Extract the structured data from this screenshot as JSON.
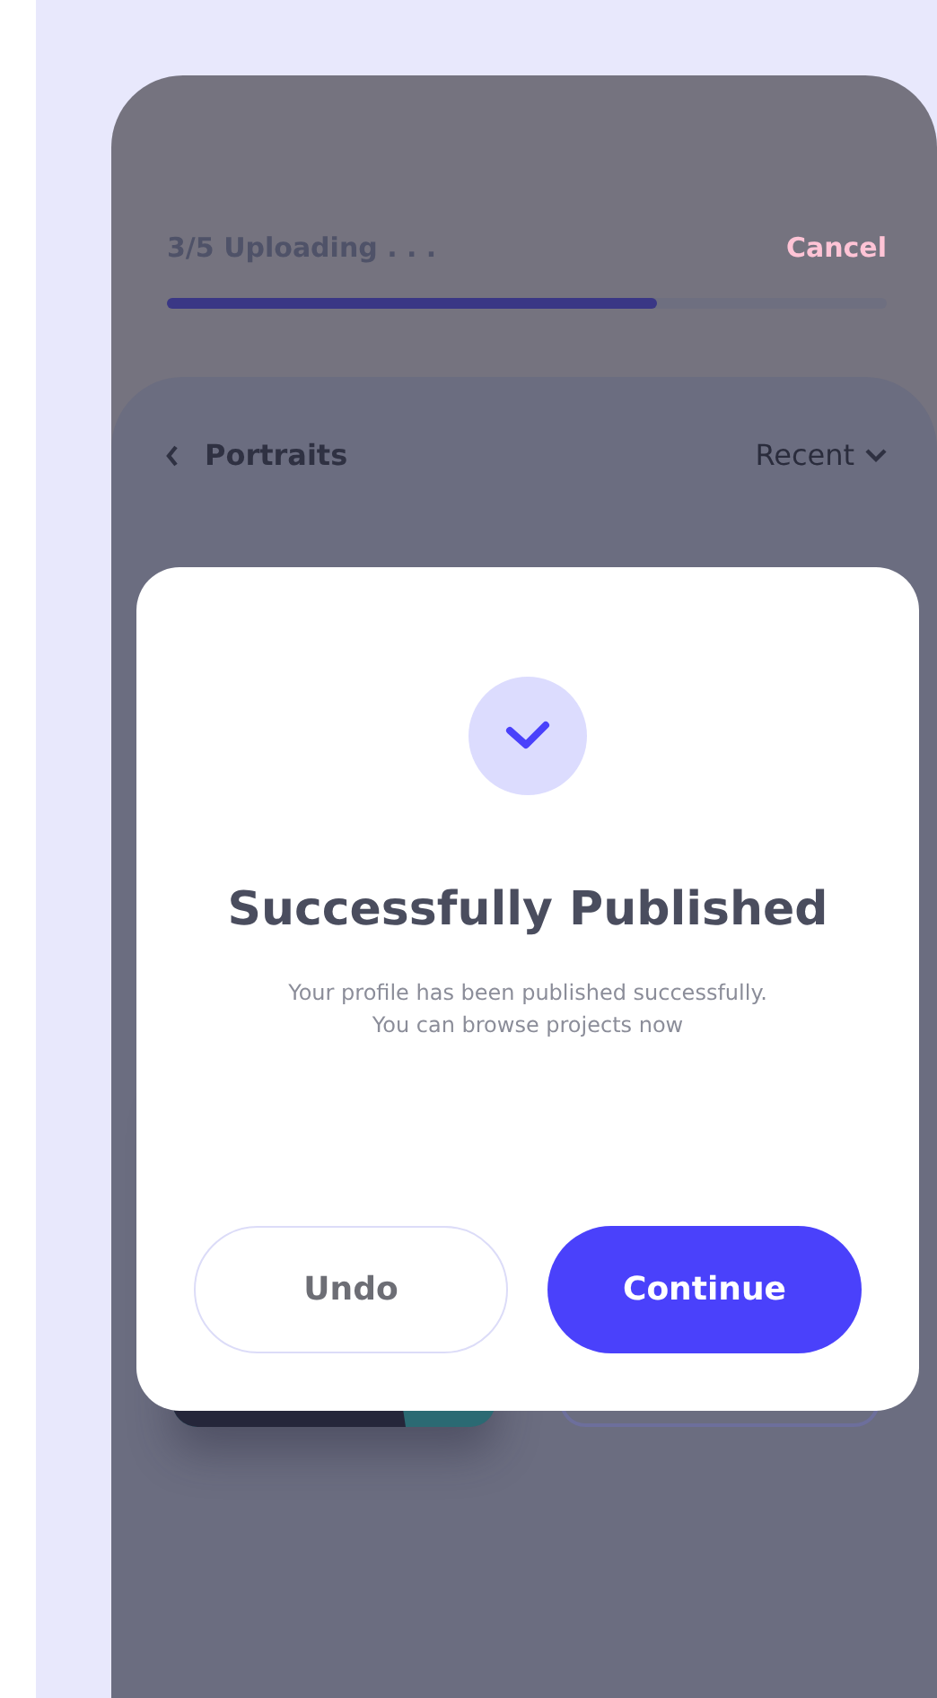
{
  "upload": {
    "status": "3/5 Uploading . . .",
    "cancel": "Cancel",
    "level": 0.68
  },
  "album": {
    "title": "Portraits",
    "sort": "Recent"
  },
  "tiles": [
    {
      "kind": "photo"
    },
    {
      "kind": "empty"
    }
  ],
  "dialog": {
    "title": "Successfully Published",
    "message": "Your profile has been published successfully.\nYou can browse projects now",
    "buttons": [
      {
        "label": "Undo",
        "kind": "secondary"
      },
      {
        "label": "Continue",
        "kind": "primary"
      }
    ]
  }
}
